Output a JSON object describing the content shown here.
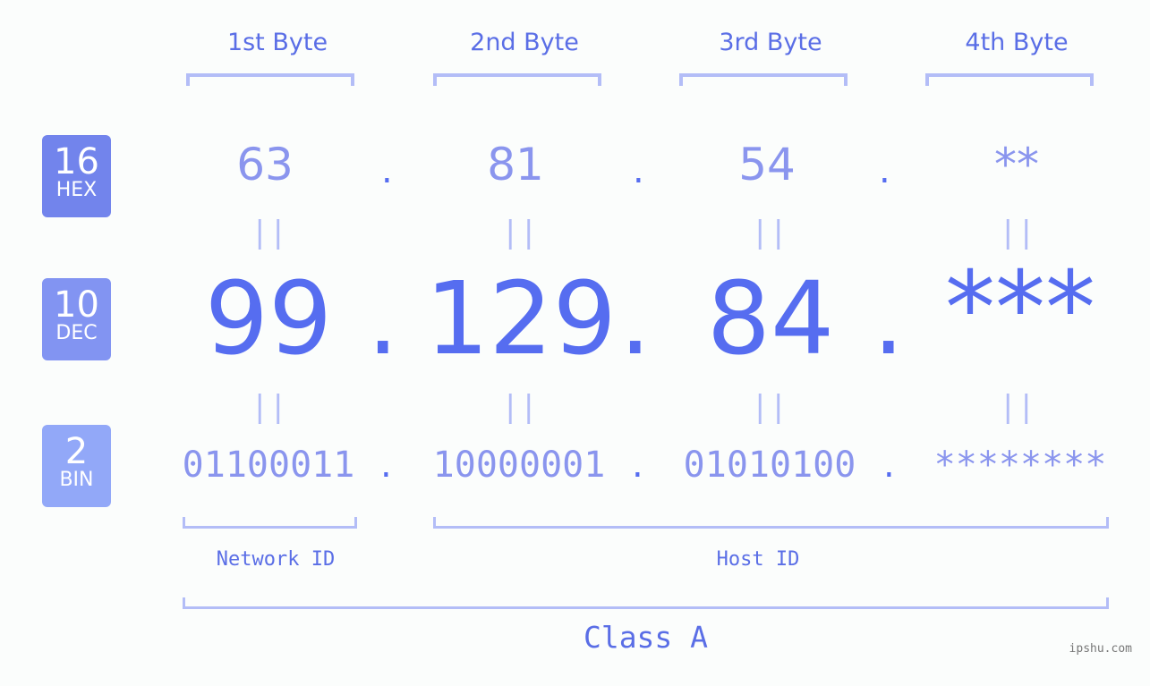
{
  "bytes": [
    {
      "label": "1st Byte",
      "hex": "63",
      "dec": "99",
      "bin": "01100011"
    },
    {
      "label": "2nd Byte",
      "hex": "81",
      "dec": "129",
      "bin": "10000001"
    },
    {
      "label": "3rd Byte",
      "hex": "54",
      "dec": "84",
      "bin": "01010100"
    },
    {
      "label": "4th Byte",
      "hex": "**",
      "dec": "***",
      "bin": "********"
    }
  ],
  "separator": ".",
  "equals": "||",
  "bases": [
    {
      "num": "16",
      "label": "HEX",
      "color": "#7284ec"
    },
    {
      "num": "10",
      "label": "DEC",
      "color": "#8294f2"
    },
    {
      "num": "2",
      "label": "BIN",
      "color": "#92a8f8"
    }
  ],
  "network_id_label": "Network ID",
  "host_id_label": "Host ID",
  "class_label": "Class A",
  "watermark": "ipshu.com"
}
